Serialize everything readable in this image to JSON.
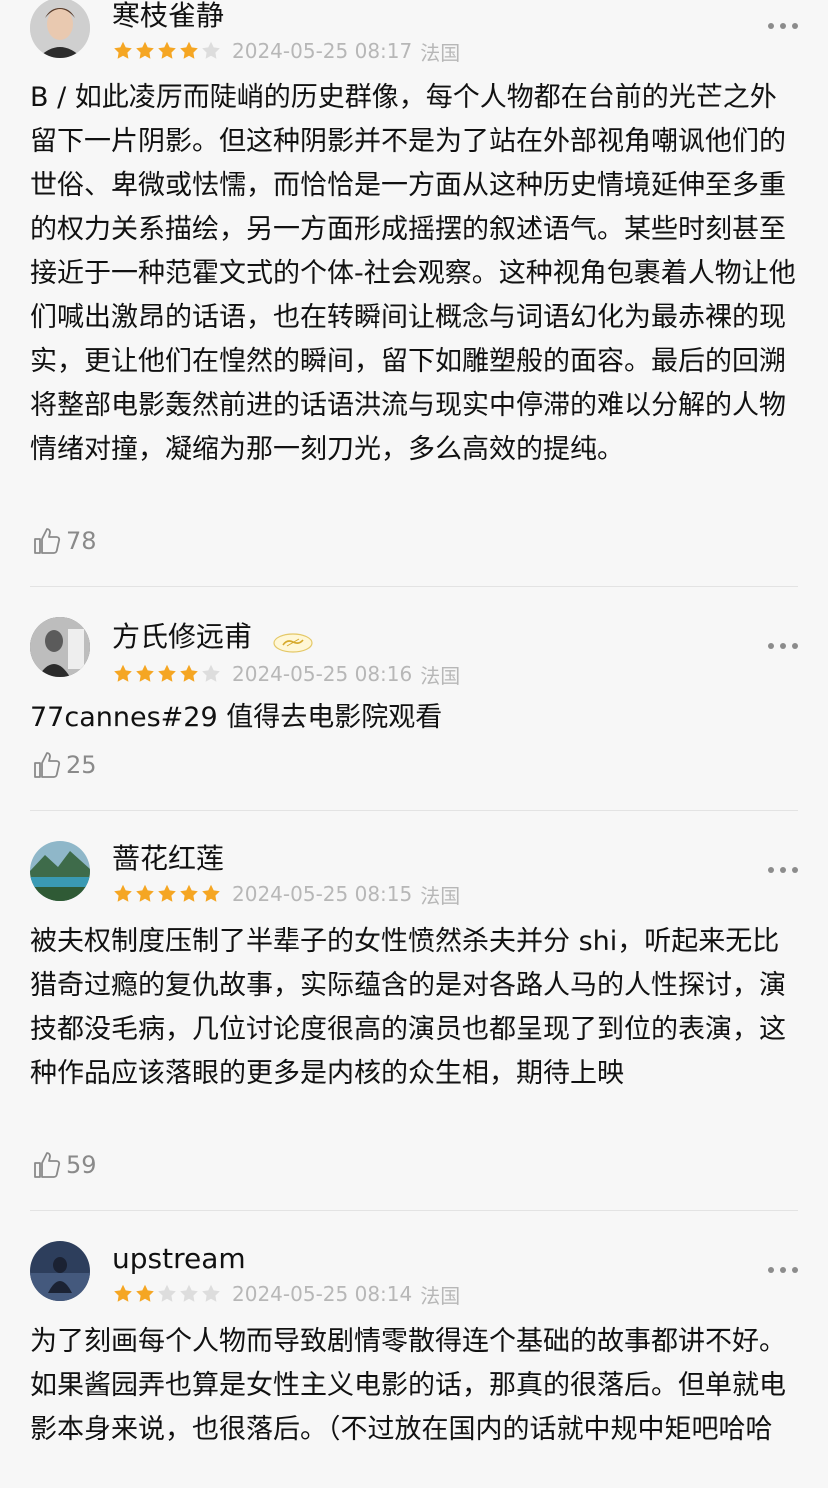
{
  "reviews": [
    {
      "username": "寒枝雀静",
      "rating": 4,
      "time": "2024-05-25 08:17",
      "location": "法国",
      "content": "B / 如此凌厉而陡峭的历史群像，每个人物都在台前的光芒之外留下一片阴影。但这种阴影并不是为了站在外部视角嘲讽他们的世俗、卑微或怯懦，而恰恰是一方面从这种历史情境延伸至多重的权力关系描绘，另一方面形成摇摆的叙述语气。某些时刻甚至接近于一种范霍文式的个体-社会观察。这种视角包裹着人物让他们喊出激昂的话语，也在转瞬间让概念与词语幻化为最赤裸的现实，更让他们在惶然的瞬间，留下如雕塑般的面容。最后的回溯将整部电影轰然前进的话语洪流与现实中停滞的难以分解的人物情绪对撞，凝缩为那一刻刀光，多么高效的提纯。",
      "likes": "78"
    },
    {
      "username": "方氏修远甫",
      "rating": 4,
      "time": "2024-05-25 08:16",
      "location": "法国",
      "content": "77cannes#29 值得去电影院观看",
      "likes": "25"
    },
    {
      "username": "蔷花红莲",
      "rating": 5,
      "time": "2024-05-25 08:15",
      "location": "法国",
      "content": "被夫权制度压制了半辈子的女性愤然杀夫并分 shi，听起来无比猎奇过瘾的复仇故事，实际蕴含的是对各路人马的人性探讨，演技都没毛病，几位讨论度很高的演员也都呈现了到位的表演，这种作品应该落眼的更多是内核的众生相，期待上映",
      "likes": "59"
    },
    {
      "username": "upstream",
      "rating": 2,
      "time": "2024-05-25 08:14",
      "location": "法国",
      "content": "为了刻画每个人物而导致剧情零散得连个基础的故事都讲不好。如果酱园弄也算是女性主义电影的话，那真的很落后。但单就电影本身来说，也很落后。（不过放在国内的话就中规中矩吧哈哈",
      "likes": ""
    }
  ],
  "colors": {
    "star_filled": "#f5a623",
    "star_empty": "#dddddd",
    "meta_text": "#b7b7b7",
    "like_text": "#8a8a8a"
  }
}
